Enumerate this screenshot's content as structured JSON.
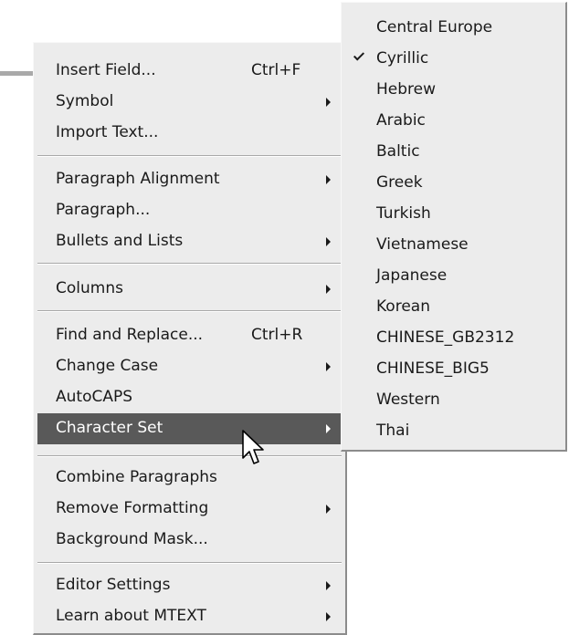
{
  "main_menu": {
    "items": [
      {
        "label": "Insert Field...",
        "shortcut": "Ctrl+F"
      },
      {
        "label": "Symbol"
      },
      {
        "label": "Import Text..."
      },
      {
        "label": "Paragraph Alignment"
      },
      {
        "label": "Paragraph..."
      },
      {
        "label": "Bullets and Lists"
      },
      {
        "label": "Columns"
      },
      {
        "label": "Find and Replace...",
        "shortcut": "Ctrl+R"
      },
      {
        "label": "Change Case"
      },
      {
        "label": "AutoCAPS"
      },
      {
        "label": "Character Set"
      },
      {
        "label": "Combine Paragraphs"
      },
      {
        "label": "Remove Formatting"
      },
      {
        "label": "Background Mask..."
      },
      {
        "label": "Editor Settings"
      },
      {
        "label": "Learn about MTEXT"
      }
    ],
    "highlighted": "Character Set",
    "highlight_color": "#595959"
  },
  "submenu": {
    "items": [
      {
        "label": "Central Europe"
      },
      {
        "label": "Cyrillic",
        "checked": true
      },
      {
        "label": "Hebrew"
      },
      {
        "label": "Arabic"
      },
      {
        "label": "Baltic"
      },
      {
        "label": "Greek"
      },
      {
        "label": "Turkish"
      },
      {
        "label": "Vietnamese"
      },
      {
        "label": "Japanese"
      },
      {
        "label": "Korean"
      },
      {
        "label": "CHINESE_GB2312"
      },
      {
        "label": "CHINESE_BIG5"
      },
      {
        "label": "Western"
      },
      {
        "label": "Thai"
      }
    ]
  },
  "colors": {
    "menu_bg": "#ececec",
    "highlight": "#595959"
  }
}
